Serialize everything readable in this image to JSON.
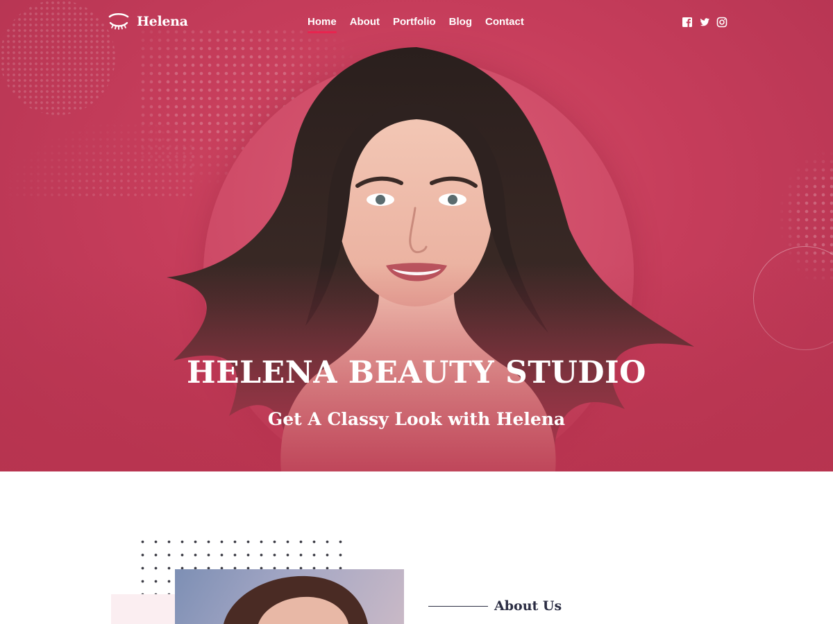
{
  "brand": {
    "name": "Helena"
  },
  "nav": {
    "items": [
      {
        "label": "Home",
        "active": true
      },
      {
        "label": "About",
        "active": false
      },
      {
        "label": "Portfolio",
        "active": false
      },
      {
        "label": "Blog",
        "active": false
      },
      {
        "label": "Contact",
        "active": false
      }
    ]
  },
  "social": [
    {
      "icon": "facebook-icon"
    },
    {
      "icon": "twitter-icon"
    },
    {
      "icon": "instagram-icon"
    }
  ],
  "hero": {
    "title": "HELENA BEAUTY STUDIO",
    "subtitle": "Get A Classy Look with Helena"
  },
  "about": {
    "heading": "About Us"
  },
  "colors": {
    "hero_bg": "#c63d5b",
    "accent": "#e8244f",
    "text_dark": "#2b2d43",
    "white": "#ffffff"
  }
}
